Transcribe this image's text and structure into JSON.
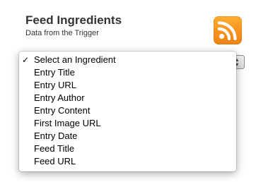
{
  "header": {
    "title": "Feed Ingredients",
    "subtitle": "Data from the Trigger",
    "icon": "rss-feed-icon"
  },
  "dropdown": {
    "selected_index": 0,
    "checkmark": "✓",
    "options": [
      "Select an Ingredient",
      "Entry Title",
      "Entry URL",
      "Entry Author",
      "Entry Content",
      "First Image URL",
      "Entry Date",
      "Feed Title",
      "Feed URL"
    ]
  },
  "colors": {
    "rss_orange": "#f7931e",
    "text": "#333333"
  }
}
